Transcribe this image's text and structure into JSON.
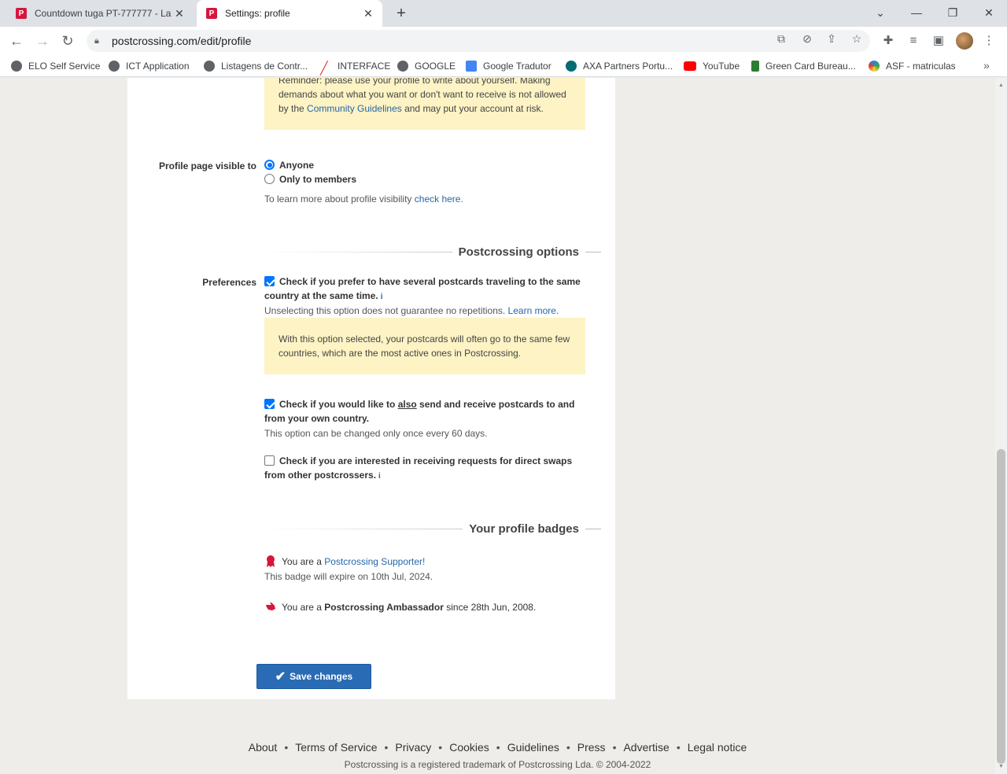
{
  "browser": {
    "tabs": [
      {
        "title": "Countdown tuga PT-777777 - La",
        "favicon": "P"
      },
      {
        "title": "Settings: profile",
        "favicon": "P"
      }
    ],
    "url": "postcrossing.com/edit/profile",
    "bookmarks": [
      {
        "label": "ELO Self Service",
        "icon": "globe-icon",
        "color": "#5f6368"
      },
      {
        "label": "ICT Application",
        "icon": "globe-icon",
        "color": "#5f6368"
      },
      {
        "label": "Listagens de Contr...",
        "icon": "globe-icon",
        "color": "#5f6368"
      },
      {
        "label": "INTERFACE",
        "icon": "slash-icon",
        "color": "#e8453c"
      },
      {
        "label": "GOOGLE",
        "icon": "globe-icon",
        "color": "#5f6368"
      },
      {
        "label": "Google Tradutor",
        "icon": "translate-icon",
        "color": "#4285f4"
      },
      {
        "label": "AXA Partners Portu...",
        "icon": "sharepoint-icon",
        "color": "#036c70"
      },
      {
        "label": "YouTube",
        "icon": "youtube-icon",
        "color": "#ff0000"
      },
      {
        "label": "Green Card Bureau...",
        "icon": "greencard-icon",
        "color": "#2e7d32"
      },
      {
        "label": "ASF - matriculas",
        "icon": "asf-icon",
        "color": "#1e88e5"
      }
    ]
  },
  "page": {
    "reminder": {
      "line1": "Reminder: please use your profile to write about yourself. Making",
      "line2": "demands about what you want or don't want to receive is not allowed",
      "line3_pre": "by the ",
      "line3_link": "Community Guidelines",
      "line3_post": " and may put your account at risk."
    },
    "visibility": {
      "label": "Profile page visible to",
      "options": [
        "Anyone",
        "Only to members"
      ],
      "selected": "Anyone",
      "help_pre": "To learn more about profile visibility ",
      "help_link": "check here."
    },
    "postcrossing_options": {
      "title": "Postcrossing options",
      "label": "Preferences",
      "pref1": {
        "text1": "Check if you prefer to have several postcards traveling to the same",
        "text2": "country at the same time.",
        "checked": true,
        "help_pre": "Unselecting this option does not guarantee no repetitions. ",
        "help_link": "Learn more.",
        "note1": "With this option selected, your postcards will often go to the same few",
        "note2": "countries, which are the most active ones in Postcrossing."
      },
      "pref2": {
        "text1_pre": "Check if you would like to ",
        "text1_em": "also",
        "text1_post": " send and receive postcards to and",
        "text2": "from your own country.",
        "checked": true,
        "help": "This option can be changed only once every 60 days."
      },
      "pref3": {
        "text1": "Check if you are interested in receiving requests for direct swaps",
        "text2": "from other postcrossers.",
        "checked": false
      }
    },
    "badges": {
      "title": "Your profile badges",
      "supporter_pre": "You are a ",
      "supporter_link": "Postcrossing Supporter!",
      "supporter_expiry": "This badge will expire on 10th Jul, 2024.",
      "ambassador_pre": "You are a ",
      "ambassador_bold": "Postcrossing Ambassador",
      "ambassador_post": " since 28th Jun, 2008."
    },
    "save_label": "Save changes",
    "footer": {
      "links": [
        "About",
        "Terms of Service",
        "Privacy",
        "Cookies",
        "Guidelines",
        "Press",
        "Advertise",
        "Legal notice"
      ],
      "legal": "Postcrossing is a registered trademark of Postcrossing Lda. © 2004-2022"
    }
  },
  "colors": {
    "link": "#2467a8",
    "note_bg": "#fdf3c4",
    "button": "#2a6bb5",
    "badge": "#d6163c"
  }
}
